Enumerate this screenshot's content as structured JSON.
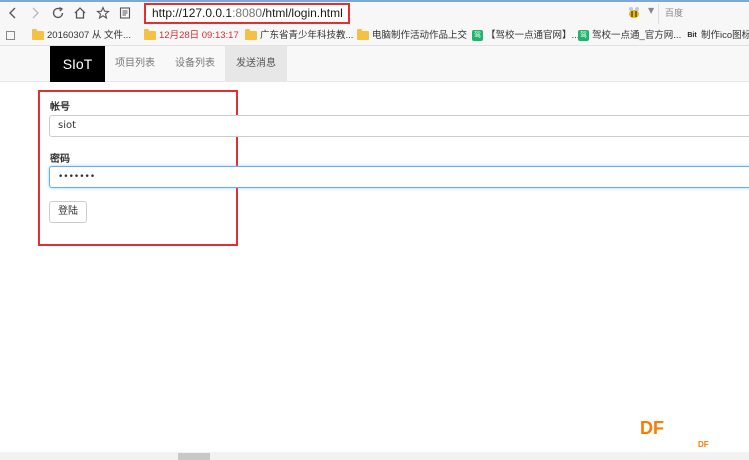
{
  "browser": {
    "url_host": "http://127.0.0.1",
    "url_port": ":8080",
    "url_path": "/html/login.html",
    "search_engine": "百度"
  },
  "bookmarks": [
    {
      "label": "20160307 从 文件...",
      "icon": "folder-icon"
    },
    {
      "label": "12月28日 09:13:17",
      "icon": "folder-icon",
      "color": "#d43030"
    },
    {
      "label": "广东省青少年科技教...",
      "icon": "folder-icon"
    },
    {
      "label": "电脑制作活动作品上交",
      "icon": "folder-icon"
    },
    {
      "label": "【驾校一点通官网】...",
      "icon": "site-icon"
    },
    {
      "label": "驾校一点通_官方网...",
      "icon": "site-icon"
    },
    {
      "label": "制作ico图标",
      "icon": "bit-icon"
    }
  ],
  "app": {
    "brand": "SIoT",
    "nav": [
      "项目列表",
      "设备列表",
      "发送消息"
    ]
  },
  "form": {
    "account_label": "帐号",
    "account_value": "siot",
    "password_label": "密码",
    "password_value": "•••••••",
    "submit_label": "登陆"
  },
  "watermark": {
    "big": "DF",
    "small": "DF"
  }
}
